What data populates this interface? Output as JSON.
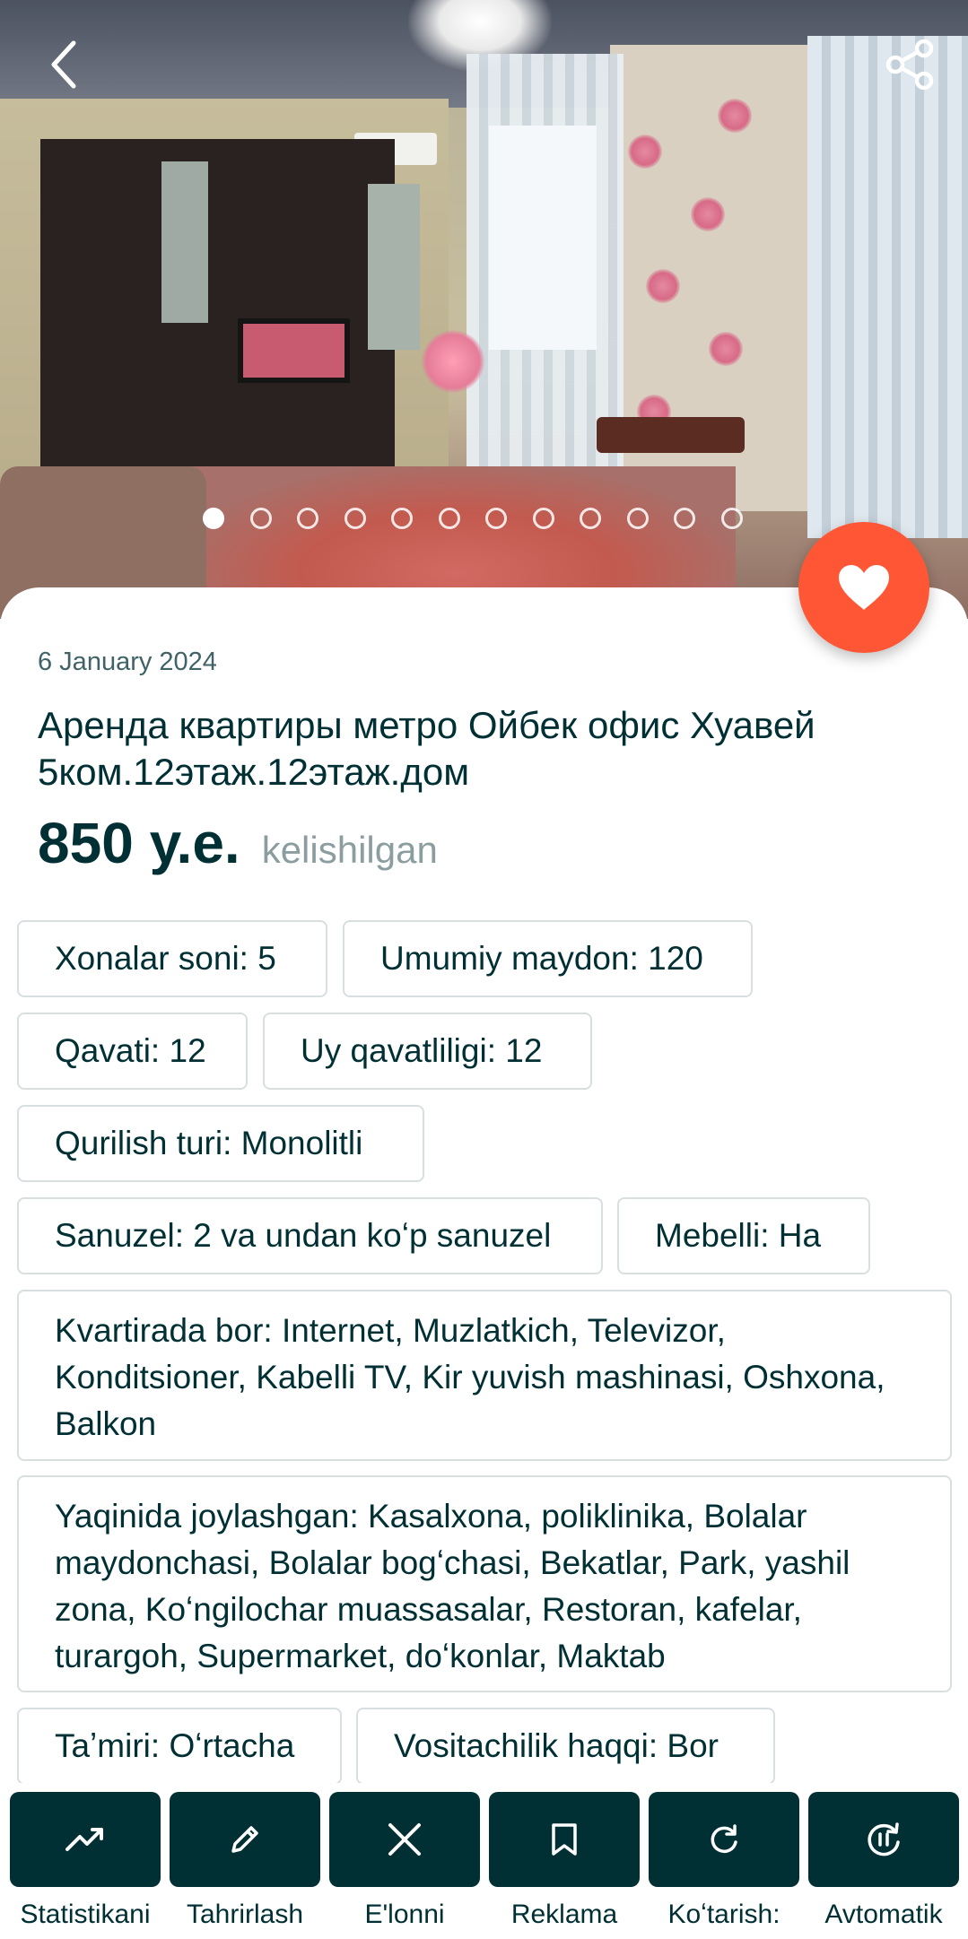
{
  "gallery": {
    "dot_count": 12,
    "active_index": 0
  },
  "listing": {
    "date": "6 January 2024",
    "title": "Аренда квартиры метро Ойбек офис Хуавей 5ком.12этаж.12этаж.дом",
    "price": "850 у.е.",
    "negotiable": "kelishilgan",
    "params": [
      "Xonalar soni: 5",
      "Umumiy maydon: 120",
      "Qavati: 12",
      "Uy qavatliligi: 12",
      "Qurilish turi: Monolitli",
      "Sanuzel: 2 va undan koʻp sanuzel",
      "Mebelli: Ha",
      "Kvartirada bor: Internet, Muzlatkich, Televizor, Konditsioner, Kabelli TV, Kir yuvish mashinasi, Oshxona, Balkon",
      "Yaqinida joylashgan: Kasalxona, poliklinika, Bolalar maydonchasi, Bolalar bogʻchasi, Bekatlar, Park, yashil zona, Koʻngilochar muassasalar, Restoran, kafelar, turargoh, Supermarket, doʻkonlar, Maktab",
      "Taʼmiri: Oʻrtacha",
      "Vositachilik haqqi: Bor"
    ]
  },
  "actions": [
    {
      "label": "Statistikani",
      "icon": "trending-up-icon"
    },
    {
      "label": "Tahrirlash",
      "icon": "pencil-icon"
    },
    {
      "label": "E'lonni",
      "icon": "close-icon"
    },
    {
      "label": "Reklama",
      "icon": "bookmark-icon"
    },
    {
      "label": "Koʻtarish:",
      "icon": "refresh-icon"
    },
    {
      "label": "Avtomatik",
      "icon": "auto-renew-icon"
    }
  ],
  "colors": {
    "primary": "#002f34",
    "favorite": "#ff5636",
    "muted": "#8c9da0",
    "border": "#d8dfe0"
  }
}
